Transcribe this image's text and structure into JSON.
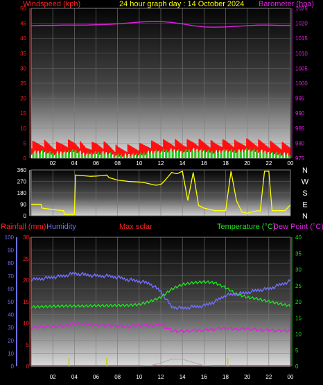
{
  "colors": {
    "background": "#000000",
    "wind_axis": "#ff2020",
    "baro_axis": "#e020e0",
    "title": "#ffff00",
    "direction": "#ffff00",
    "rain": "#ff2020",
    "humidity": "#7070ff",
    "solar": "#ff2020",
    "temperature": "#20e020",
    "dewpoint": "#e020e0",
    "gust": "#ff1010",
    "wind_avg": "#20d020",
    "wind_light": "#ffffff"
  },
  "chart_data": [
    {
      "type": "line",
      "title": "24 hour graph day : 14 October 2024",
      "left_label": "Windspeed (kph)",
      "right_label": "Barometer (hpa)",
      "x_ticks": [
        "02",
        "04",
        "06",
        "08",
        "10",
        "12",
        "14",
        "16",
        "18",
        "20",
        "22",
        "00"
      ],
      "y_left_ticks": [
        "0",
        "5",
        "10",
        "15",
        "20",
        "25",
        "30",
        "35",
        "40",
        "45",
        "50"
      ],
      "y_right_ticks": [
        "975",
        "980",
        "985",
        "990",
        "995",
        "1000",
        "1005",
        "1010",
        "1015",
        "1020",
        "1025"
      ],
      "ylim_left": [
        0,
        50
      ],
      "ylim_right": [
        975,
        1025
      ],
      "x": [
        0,
        1,
        2,
        3,
        4,
        5,
        6,
        7,
        8,
        9,
        10,
        11,
        12,
        13,
        14,
        15,
        16,
        17,
        18,
        19,
        20,
        21,
        22,
        23,
        24
      ],
      "series": [
        {
          "name": "Barometer",
          "axis": "right",
          "values": [
            1019.2,
            1019.3,
            1019.3,
            1019.4,
            1019.4,
            1019.4,
            1019.5,
            1019.6,
            1019.8,
            1020.1,
            1020.4,
            1020.6,
            1020.6,
            1020.3,
            1019.8,
            1019.2,
            1018.8,
            1018.7,
            1018.8,
            1019.0,
            1019.2,
            1019.4,
            1019.4,
            1019.3,
            1019.3
          ]
        },
        {
          "name": "Gust",
          "axis": "left",
          "values": [
            4.5,
            5.0,
            4.0,
            4.8,
            5.2,
            3.5,
            4.6,
            4.2,
            3.0,
            3.4,
            3.8,
            4.6,
            5.0,
            5.2,
            4.8,
            5.4,
            5.0,
            4.6,
            5.2,
            4.8,
            5.4,
            5.0,
            4.6,
            4.2,
            4.0
          ]
        },
        {
          "name": "Average",
          "axis": "left",
          "values": [
            1.8,
            2.2,
            1.5,
            1.9,
            2.5,
            1.2,
            1.8,
            1.6,
            0.9,
            1.0,
            1.2,
            2.0,
            2.4,
            2.6,
            2.2,
            2.8,
            2.4,
            2.0,
            2.6,
            2.2,
            2.8,
            2.4,
            1.8,
            1.4,
            1.2
          ]
        }
      ]
    },
    {
      "type": "line",
      "title": "",
      "y_ticks": [
        "0",
        "90",
        "180",
        "270",
        "360"
      ],
      "ylim": [
        0,
        360
      ],
      "compass": [
        "N",
        "W",
        "S",
        "E",
        "N"
      ],
      "x": [
        0,
        0.9,
        1,
        2.9,
        3,
        3.1,
        4.0,
        4.1,
        5.5,
        6.0,
        6.5,
        7.0,
        7.2,
        8.0,
        9.0,
        10.0,
        10.5,
        11.0,
        11.5,
        12.0,
        12.3,
        12.6,
        13.0,
        13.5,
        14.0,
        14.5,
        15.0,
        15.5,
        16.0,
        17.0,
        18.0,
        18.5,
        19.0,
        19.5,
        20.0,
        21.0,
        21.2,
        21.6,
        22.0,
        22.3,
        23.0,
        23.5,
        24.0
      ],
      "values": [
        90,
        90,
        60,
        40,
        40,
        10,
        10,
        320,
        310,
        312,
        315,
        320,
        300,
        280,
        270,
        265,
        260,
        250,
        240,
        245,
        270,
        300,
        340,
        330,
        350,
        120,
        340,
        80,
        60,
        40,
        40,
        350,
        120,
        30,
        20,
        40,
        35,
        350,
        350,
        40,
        40,
        40,
        85
      ]
    },
    {
      "type": "line",
      "title": "",
      "left_labels": [
        "Rainfall (mm)",
        "Humidity"
      ],
      "center_label": "Max solar",
      "right_labels": [
        "Temperature (°C)",
        "Dew Point (°C)"
      ],
      "x_ticks": [
        "02",
        "04",
        "06",
        "08",
        "10",
        "12",
        "14",
        "16",
        "18",
        "20",
        "22",
        "00"
      ],
      "y_humidity_ticks": [
        "0",
        "10",
        "20",
        "30",
        "40",
        "50",
        "60",
        "70",
        "80",
        "90",
        "100"
      ],
      "y_rain_ticks": [
        "0",
        "5",
        "10",
        "15",
        "20",
        "25",
        "30"
      ],
      "y_temp_ticks": [
        "0",
        "5",
        "10",
        "15",
        "20",
        "25",
        "30",
        "35",
        "40"
      ],
      "ylim_humidity": [
        0,
        100
      ],
      "ylim_rain": [
        0,
        30
      ],
      "ylim_temp": [
        0,
        40
      ],
      "x": [
        0,
        1,
        2,
        3,
        4,
        5,
        6,
        7,
        8,
        9,
        10,
        11,
        12,
        13,
        14,
        15,
        16,
        17,
        18,
        19,
        20,
        21,
        22,
        23,
        24
      ],
      "series": [
        {
          "name": "Humidity",
          "axis": "humidity",
          "values": [
            67,
            68,
            69,
            70,
            72,
            71,
            70,
            70,
            69,
            67,
            66,
            64,
            58,
            46,
            45,
            46,
            47,
            50,
            55,
            56,
            57,
            59,
            60,
            63,
            66
          ]
        },
        {
          "name": "Temperature (°C)",
          "axis": "temp",
          "values": [
            18.5,
            18.6,
            18.7,
            18.8,
            18.8,
            18.8,
            18.9,
            18.9,
            19.0,
            19.0,
            19.3,
            20.2,
            21.5,
            24.0,
            25.5,
            26.0,
            26.3,
            26.0,
            24.5,
            22.5,
            21.5,
            21.0,
            20.2,
            19.5,
            18.8
          ]
        },
        {
          "name": "Dew Point (°C)",
          "axis": "temp",
          "values": [
            12.0,
            12.2,
            12.3,
            12.5,
            13.2,
            13.0,
            12.8,
            12.8,
            12.5,
            12.3,
            12.8,
            12.6,
            13.0,
            11.0,
            10.8,
            11.0,
            11.2,
            11.5,
            11.8,
            11.5,
            11.6,
            11.3,
            11.2,
            11.0,
            11.2
          ]
        },
        {
          "name": "Max solar",
          "axis": "humidity",
          "values": [
            0,
            0,
            0,
            0,
            0,
            0,
            0,
            0,
            0,
            0,
            0,
            0.5,
            2.5,
            5.5,
            5.5,
            3,
            0.5,
            0,
            0,
            0,
            0,
            0,
            0,
            0,
            0
          ]
        }
      ]
    }
  ]
}
